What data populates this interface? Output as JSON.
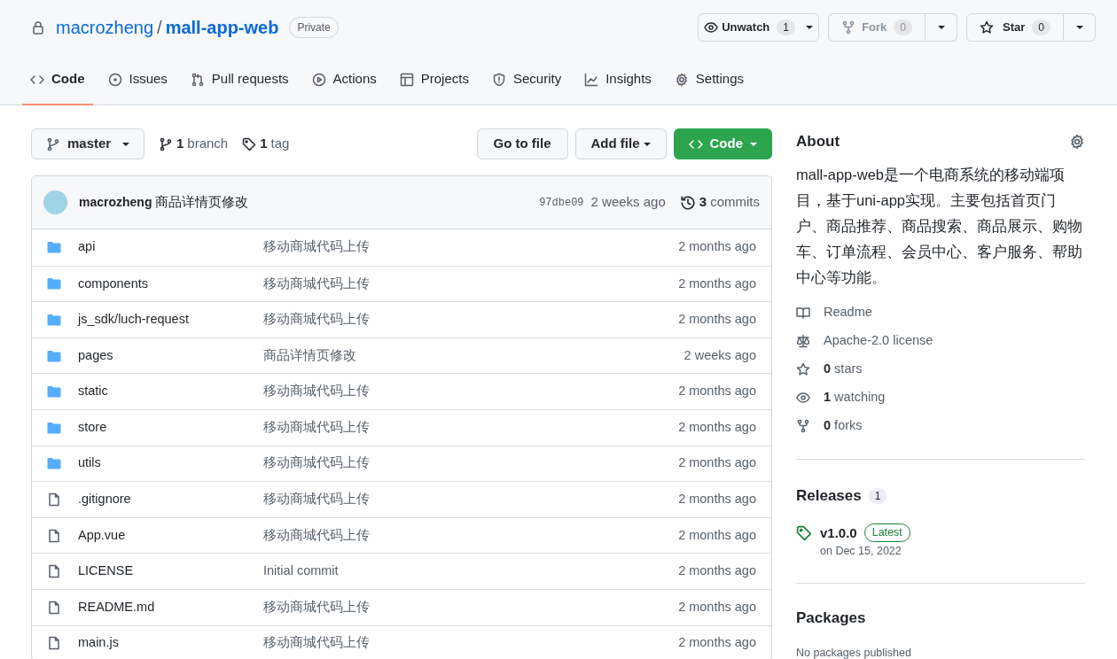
{
  "repo": {
    "owner": "macrozheng",
    "separator": "/",
    "name": "mall-app-web",
    "visibility": "Private"
  },
  "repo_actions": [
    {
      "kind": "watch",
      "label": "Unwatch",
      "count": "1",
      "disabled": false
    },
    {
      "kind": "fork",
      "label": "Fork",
      "count": "0",
      "disabled": true
    },
    {
      "kind": "star",
      "label": "Star",
      "count": "0",
      "disabled": false
    }
  ],
  "tabs": [
    {
      "kind": "code",
      "label": "Code",
      "selected": true
    },
    {
      "kind": "issues",
      "label": "Issues",
      "selected": false
    },
    {
      "kind": "pulls",
      "label": "Pull requests",
      "selected": false
    },
    {
      "kind": "actions",
      "label": "Actions",
      "selected": false
    },
    {
      "kind": "projects",
      "label": "Projects",
      "selected": false
    },
    {
      "kind": "security",
      "label": "Security",
      "selected": false
    },
    {
      "kind": "insights",
      "label": "Insights",
      "selected": false
    },
    {
      "kind": "settings",
      "label": "Settings",
      "selected": false
    }
  ],
  "toolbar": {
    "branch": "master",
    "branches": {
      "count": "1",
      "label": "branch"
    },
    "tags": {
      "count": "1",
      "label": "tag"
    },
    "go_to_file": "Go to file",
    "add_file": "Add file",
    "code": "Code"
  },
  "latest_commit": {
    "author": "macrozheng",
    "message": "商品详情页修改",
    "sha": "97dbe09",
    "time": "2 weeks ago",
    "commits_count": "3",
    "commits_label": "commits"
  },
  "files": [
    {
      "kind": "dir",
      "name": "api",
      "message": "移动商城代码上传",
      "time": "2 months ago"
    },
    {
      "kind": "dir",
      "name": "components",
      "message": "移动商城代码上传",
      "time": "2 months ago"
    },
    {
      "kind": "dir",
      "name": "js_sdk/luch-request",
      "message": "移动商城代码上传",
      "time": "2 months ago"
    },
    {
      "kind": "dir",
      "name": "pages",
      "message": "商品详情页修改",
      "time": "2 weeks ago"
    },
    {
      "kind": "dir",
      "name": "static",
      "message": "移动商城代码上传",
      "time": "2 months ago"
    },
    {
      "kind": "dir",
      "name": "store",
      "message": "移动商城代码上传",
      "time": "2 months ago"
    },
    {
      "kind": "dir",
      "name": "utils",
      "message": "移动商城代码上传",
      "time": "2 months ago"
    },
    {
      "kind": "file",
      "name": ".gitignore",
      "message": "移动商城代码上传",
      "time": "2 months ago"
    },
    {
      "kind": "file",
      "name": "App.vue",
      "message": "移动商城代码上传",
      "time": "2 months ago"
    },
    {
      "kind": "file",
      "name": "LICENSE",
      "message": "Initial commit",
      "time": "2 months ago"
    },
    {
      "kind": "file",
      "name": "README.md",
      "message": "移动商城代码上传",
      "time": "2 months ago"
    },
    {
      "kind": "file",
      "name": "main.js",
      "message": "移动商城代码上传",
      "time": "2 months ago"
    }
  ],
  "about": {
    "title": "About",
    "description": "mall-app-web是一个电商系统的移动端项目，基于uni-app实现。主要包括首页门户、商品推荐、商品搜索、商品展示、购物车、订单流程、会员中心、客户服务、帮助中心等功能。",
    "links": [
      {
        "kind": "readme",
        "label": "Readme"
      },
      {
        "kind": "license",
        "label": "Apache-2.0 license"
      },
      {
        "kind": "stars",
        "count": "0",
        "label": "stars"
      },
      {
        "kind": "watchers",
        "count": "1",
        "label": "watching"
      },
      {
        "kind": "forks",
        "count": "0",
        "label": "forks"
      }
    ]
  },
  "releases": {
    "title": "Releases",
    "count": "1",
    "tag": "v1.0.0",
    "badge": "Latest",
    "date": "on Dec 15, 2022"
  },
  "packages": {
    "title": "Packages",
    "note": "No packages published"
  }
}
